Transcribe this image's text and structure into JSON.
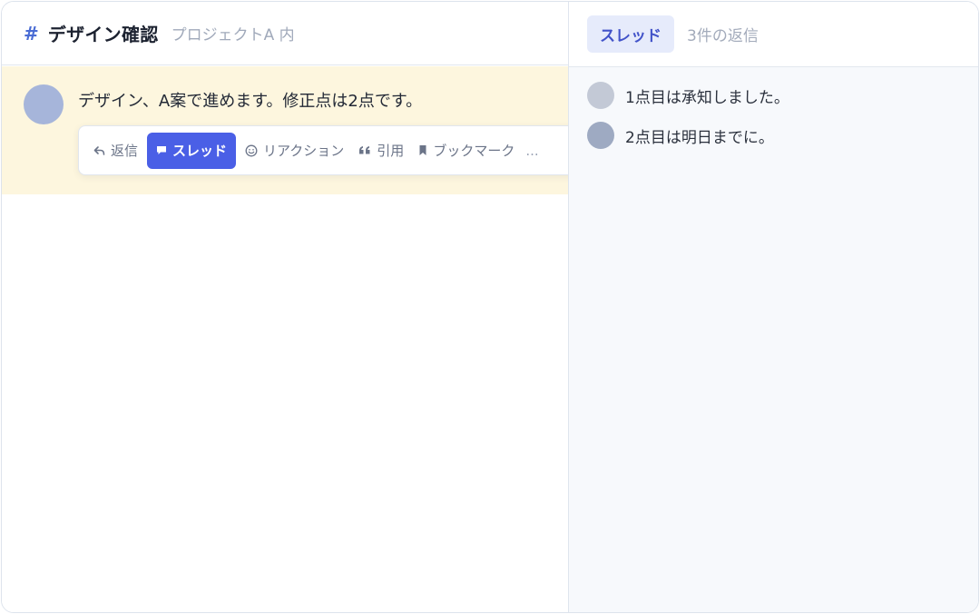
{
  "channel": {
    "hash": "#",
    "name": "デザイン確認",
    "scope": "プロジェクトA 内"
  },
  "message": {
    "text": "デザイン、A案で進めます。修正点は2点です。"
  },
  "actions": {
    "reply": "返信",
    "thread": "スレッド",
    "reaction": "リアクション",
    "quote": "引用",
    "bookmark": "ブックマーク",
    "more": "..."
  },
  "icons": {
    "reply": "reply-arrow-icon",
    "thread": "thread-icon",
    "reaction": "smiley-icon",
    "quote": "quote-icon",
    "bookmark": "bookmark-icon"
  },
  "thread": {
    "tab_label": "スレッド",
    "reply_count": "3件の返信",
    "replies": [
      {
        "text": "1点目は承知しました。",
        "avatar_color": "#c3c9d6"
      },
      {
        "text": "2点目は明日までに。",
        "avatar_color": "#9eaac2"
      }
    ]
  },
  "colors": {
    "accent": "#4a5fe6",
    "highlight_bg": "#fdf6de",
    "hash": "#4a6cd4"
  }
}
